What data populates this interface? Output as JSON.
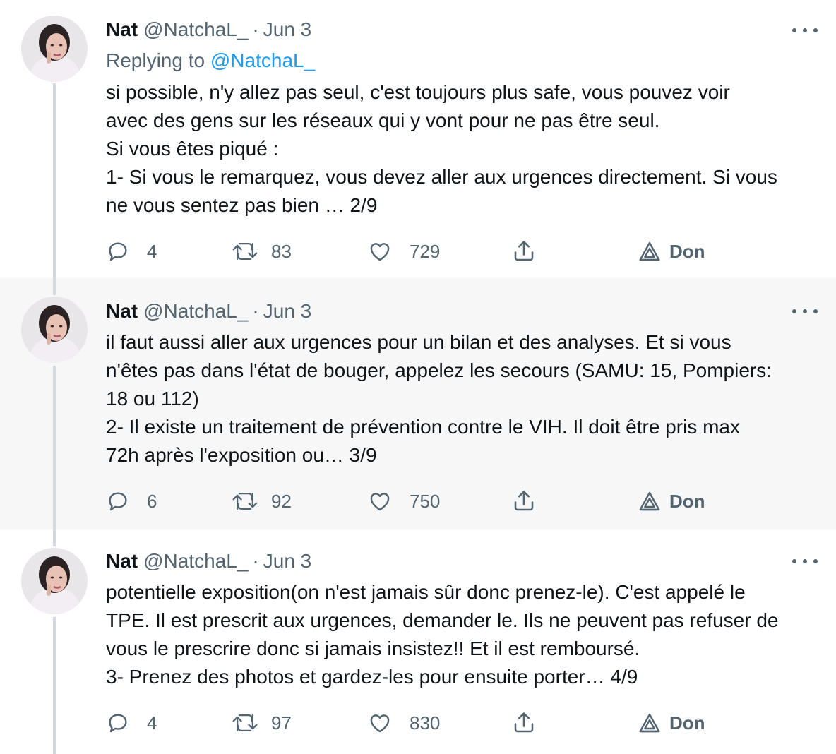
{
  "tweets": [
    {
      "name": "Nat",
      "handle": "@NatchaL_",
      "separator": "·",
      "date": "Jun 3",
      "replying_prefix": "Replying to",
      "replying_to": "@NatchaL_",
      "lines": [
        "si possible, n'y allez pas seul, c'est toujours plus safe, vous pouvez voir",
        "avec des gens sur les réseaux qui y vont pour ne pas être seul.",
        "Si vous êtes piqué :",
        "1- Si vous le remarquez, vous devez aller aux urgences directement. Si vous",
        "ne vous sentez pas bien … 2/9"
      ],
      "replies": "4",
      "retweets": "83",
      "likes": "729",
      "promo_label": "Don"
    },
    {
      "name": "Nat",
      "handle": "@NatchaL_",
      "separator": "·",
      "date": "Jun 3",
      "lines": [
        "il faut aussi aller aux urgences pour un bilan et des analyses. Et si vous",
        "n'êtes pas dans l'état de bouger, appelez les secours (SAMU: 15, Pompiers:",
        "18 ou 112)",
        "2- Il existe un traitement de prévention contre le VIH. Il doit être pris max",
        "72h après l'exposition ou… 3/9"
      ],
      "replies": "6",
      "retweets": "92",
      "likes": "750",
      "promo_label": "Don"
    },
    {
      "name": "Nat",
      "handle": "@NatchaL_",
      "separator": "·",
      "date": "Jun 3",
      "lines": [
        "potentielle exposition(on n'est jamais sûr donc prenez-le). C'est appelé le",
        "TPE. Il est prescrit aux urgences, demander le. Ils ne peuvent pas refuser de",
        "vous le prescrire donc si jamais insistez!! Et il est remboursé.",
        "3- Prenez des photos et gardez-les pour ensuite porter… 4/9"
      ],
      "replies": "4",
      "retweets": "97",
      "likes": "830",
      "promo_label": "Don"
    }
  ],
  "colors": {
    "text": "#0f1419",
    "muted": "#536471",
    "link": "#1d9bf0",
    "thread_line": "#cfd9de",
    "highlight_bg": "#f7f7f7"
  }
}
